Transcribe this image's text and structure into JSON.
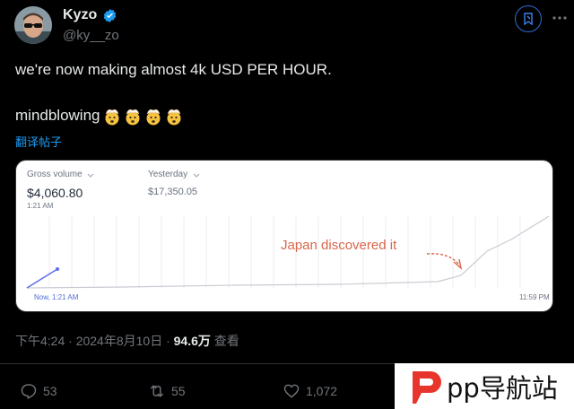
{
  "author": {
    "name": "Kyzo",
    "handle": "@ky__zo",
    "verified_color": "#1d9bf0"
  },
  "tweet": {
    "line1": "we're now making almost 4k USD PER HOUR.",
    "line2": "mindblowing",
    "emoji_count": 4,
    "translate_link": "翻译帖子"
  },
  "dashboard": {
    "gross_label": "Gross volume",
    "gross_value": "$4,060.80",
    "gross_time": "1:21 AM",
    "yesterday_label": "Yesterday",
    "yesterday_value": "$17,350.05",
    "annotation": "Japan discovered it",
    "x_start": "Now, 1:21 AM",
    "x_end": "11:59 PM"
  },
  "meta": {
    "time_date": "下午4:24 · 2024年8月10日 · ",
    "views": "94.6万",
    "views_suffix": " 查看"
  },
  "actions": {
    "replies": "53",
    "retweets": "55",
    "likes": "1,072"
  },
  "watermark": {
    "text": "pp导航站",
    "color": "#e8352b"
  }
}
